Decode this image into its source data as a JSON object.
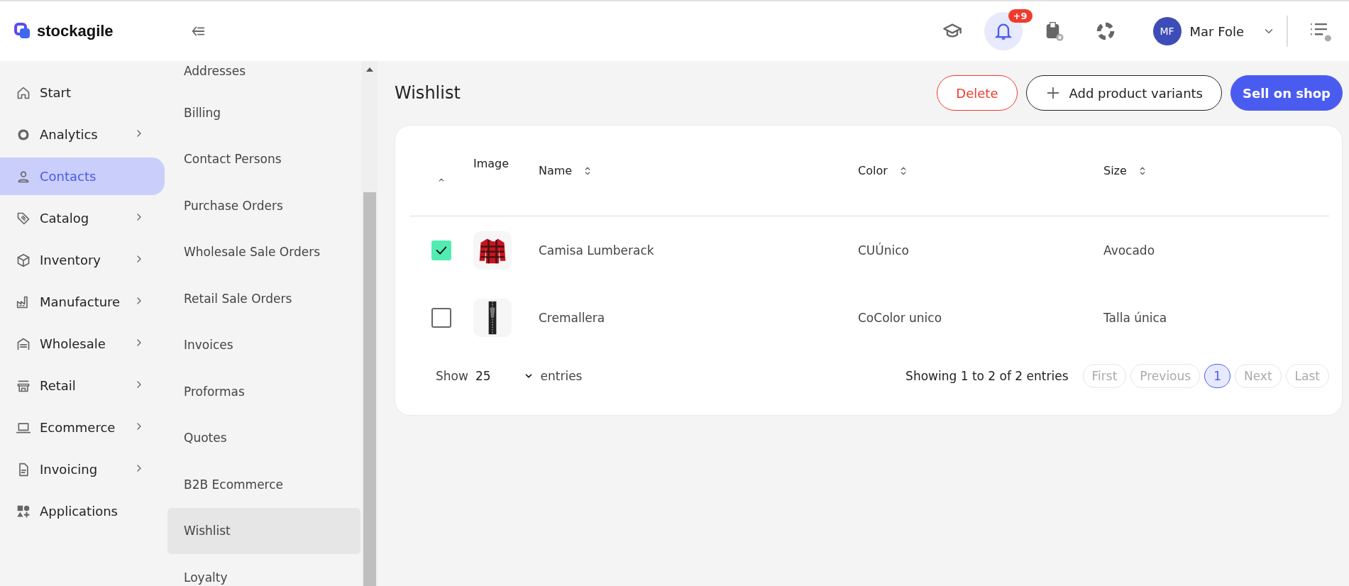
{
  "header": {
    "logo": "stockagile",
    "notifications_badge": "+9",
    "user": {
      "initials": "MF",
      "name": "Mar Fole"
    }
  },
  "sidebar": {
    "items": [
      {
        "label": "Start",
        "selected": false,
        "expandable": false
      },
      {
        "label": "Analytics",
        "selected": false,
        "expandable": true
      },
      {
        "label": "Contacts",
        "selected": true,
        "expandable": false
      },
      {
        "label": "Catalog",
        "selected": false,
        "expandable": true
      },
      {
        "label": "Inventory",
        "selected": false,
        "expandable": true
      },
      {
        "label": "Manufacture",
        "selected": false,
        "expandable": true
      },
      {
        "label": "Wholesale",
        "selected": false,
        "expandable": true
      },
      {
        "label": "Retail",
        "selected": false,
        "expandable": true
      },
      {
        "label": "Ecommerce",
        "selected": false,
        "expandable": true
      },
      {
        "label": "Invoicing",
        "selected": false,
        "expandable": true
      },
      {
        "label": "Applications",
        "selected": false,
        "expandable": false
      }
    ]
  },
  "submenu": {
    "items": [
      {
        "label": "Addresses",
        "selected": false
      },
      {
        "label": "Billing",
        "selected": false
      },
      {
        "label": "Contact Persons",
        "selected": false
      },
      {
        "label": "Purchase Orders",
        "selected": false
      },
      {
        "label": "Wholesale Sale Orders",
        "selected": false
      },
      {
        "label": "Retail Sale Orders",
        "selected": false
      },
      {
        "label": "Invoices",
        "selected": false
      },
      {
        "label": "Proformas",
        "selected": false
      },
      {
        "label": "Quotes",
        "selected": false
      },
      {
        "label": "B2B Ecommerce",
        "selected": false
      },
      {
        "label": "Wishlist",
        "selected": true
      },
      {
        "label": "Loyalty",
        "selected": false
      }
    ]
  },
  "page": {
    "title": "Wishlist",
    "buttons": [
      {
        "label": "Delete",
        "kind": "danger"
      },
      {
        "label": "Add product variants",
        "kind": "add"
      },
      {
        "label": "Sell on shop",
        "kind": "primary"
      }
    ]
  },
  "table": {
    "columns": [
      {
        "label": "Image",
        "sortable": false
      },
      {
        "label": "Name",
        "sortable": true
      },
      {
        "label": "Color",
        "sortable": true
      },
      {
        "label": "Size",
        "sortable": true
      }
    ],
    "rows": [
      {
        "checked": true,
        "kind": "shirt",
        "name": "Camisa Lumberack",
        "color_label": "CUÚnico",
        "size": "Avocado"
      },
      {
        "checked": false,
        "kind": "zipper",
        "name": "Cremallera",
        "color_label": "CoColor unico",
        "size": "Talla única"
      }
    ]
  },
  "footer": {
    "show_label": "Show",
    "page_size": "25",
    "entries_label": "entries",
    "summary": "Showing 1 to 2 of 2 entries",
    "pagination": [
      {
        "label": "First",
        "selected": false,
        "disabled": true
      },
      {
        "label": "Previous",
        "selected": false,
        "disabled": true
      },
      {
        "label": "1",
        "selected": true,
        "disabled": false
      },
      {
        "label": "Next",
        "selected": false,
        "disabled": true
      },
      {
        "label": "Last",
        "selected": false,
        "disabled": true
      }
    ]
  }
}
